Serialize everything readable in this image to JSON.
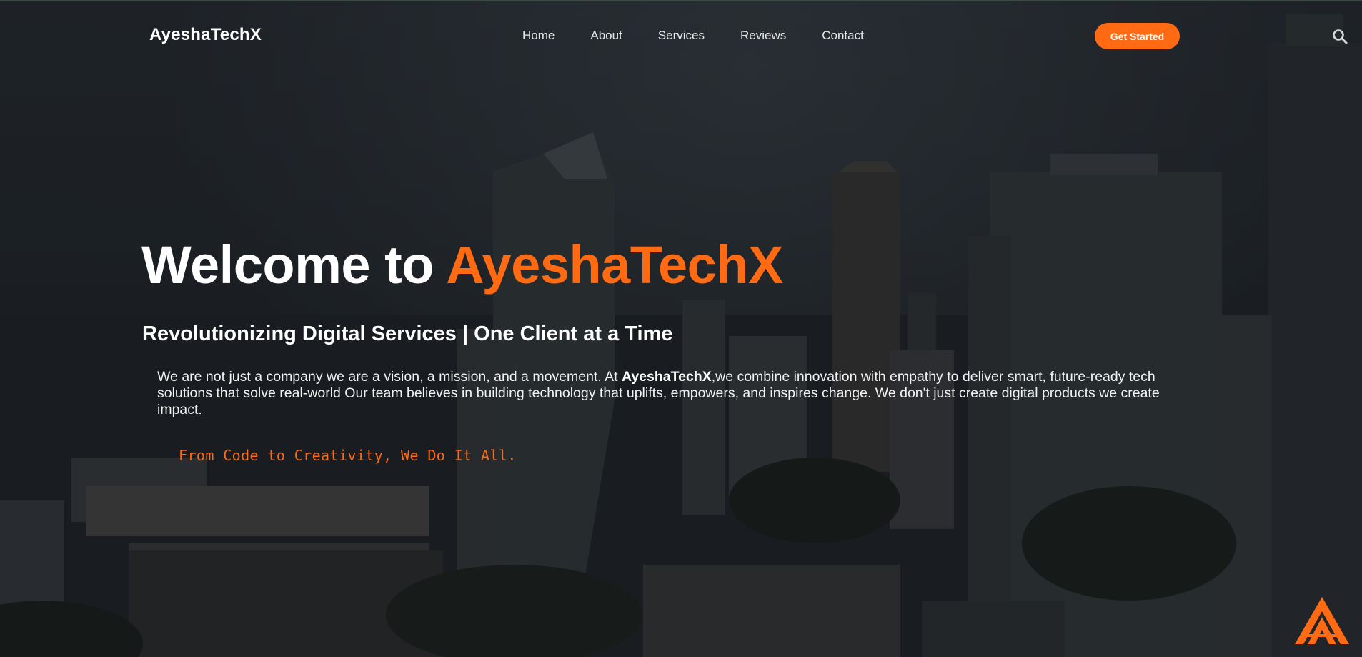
{
  "brand": {
    "name": "AyeshaTechX",
    "accent_color": "#ff6a13"
  },
  "nav": {
    "items": [
      {
        "label": "Home"
      },
      {
        "label": "About"
      },
      {
        "label": "Services"
      },
      {
        "label": "Reviews"
      },
      {
        "label": "Contact"
      }
    ],
    "cta_label": "Get Started",
    "search_icon": "search-icon"
  },
  "hero": {
    "title_prefix": "Welcome to ",
    "title_brand": "AyeshaTechX",
    "subtitle": "Revolutionizing Digital Services | One Client at a Time",
    "para_before": "We are not just a company we are a vision, a mission, and a movement. At ",
    "para_brand": "AyeshaTechX",
    "para_after": ",we combine innovation with empathy to deliver smart, future-ready tech solutions that solve real-world Our team believes in building technology that uplifts, empowers, and inspires change. We don't just create digital products we create impact.",
    "tagline": "From Code to Creativity, We Do It All."
  },
  "corner_logo_icon": "brand-mark-icon"
}
